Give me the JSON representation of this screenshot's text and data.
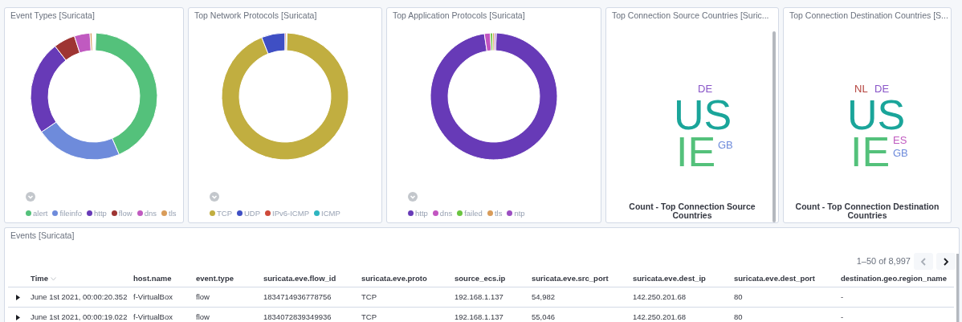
{
  "panels": [
    {
      "kind": "donut",
      "title": "Event Types [Suricata]",
      "legend": [
        {
          "label": "alert",
          "color": "#54c17b"
        },
        {
          "label": "fileinfo",
          "color": "#6e8bdb"
        },
        {
          "label": "http",
          "color": "#673ab7"
        },
        {
          "label": "flow",
          "color": "#9e3533"
        },
        {
          "label": "dns",
          "color": "#c05ac0"
        },
        {
          "label": "tls",
          "color": "#d99c5a"
        }
      ]
    },
    {
      "kind": "donut",
      "title": "Top Network Protocols [Suricata]",
      "legend": [
        {
          "label": "TCP",
          "color": "#c1ae40"
        },
        {
          "label": "UDP",
          "color": "#3f4fc4"
        },
        {
          "label": "IPv6-ICMP",
          "color": "#cf4a3a"
        },
        {
          "label": "ICMP",
          "color": "#2eb5c0"
        }
      ]
    },
    {
      "kind": "donut",
      "title": "Top Application Protocols [Suricata]",
      "legend": [
        {
          "label": "http",
          "color": "#673ab7"
        },
        {
          "label": "dns",
          "color": "#c255c1"
        },
        {
          "label": "failed",
          "color": "#6ac440"
        },
        {
          "label": "tls",
          "color": "#d99c5a"
        },
        {
          "label": "ntp",
          "color": "#9b4ec2"
        }
      ]
    },
    {
      "kind": "cloud",
      "title": "Top Connection Source Countries [Suric...",
      "caption": "Count - Top Connection Source Countries",
      "words": [
        {
          "text": "DE",
          "kind": "small",
          "color": "#8a56c8"
        },
        {
          "text": "US",
          "kind": "large",
          "color": "#1aa59a"
        },
        {
          "text": "IE",
          "kind": "large",
          "color": "#54c17b"
        },
        {
          "text": "GB",
          "kind": "small",
          "color": "#6e8bdb"
        }
      ]
    },
    {
      "kind": "cloud",
      "title": "Top Connection Destination Countries [S...",
      "caption": "Count - Top Connection Destination Countries",
      "words": [
        {
          "text": "NL",
          "kind": "small",
          "color": "#b5443e"
        },
        {
          "text": "DE",
          "kind": "small",
          "color": "#8a56c8"
        },
        {
          "text": "US",
          "kind": "large",
          "color": "#1aa59a"
        },
        {
          "text": "IE",
          "kind": "large",
          "color": "#54c17b"
        },
        {
          "text": "ES",
          "kind": "small",
          "color": "#c05ac0"
        },
        {
          "text": "GB",
          "kind": "small",
          "color": "#6e8bdb"
        }
      ]
    }
  ],
  "events": {
    "title": "Events [Suricata]",
    "pager": {
      "text": "1–50 of 8,997",
      "prev_disabled": true,
      "next_disabled": false
    },
    "table": {
      "columns": [
        "Time",
        "host.name",
        "event.type",
        "suricata.eve.flow_id",
        "suricata.eve.proto",
        "source_ecs.ip",
        "suricata.eve.src_port",
        "suricata.eve.dest_ip",
        "suricata.eve.dest_port",
        "destination.geo.region_name"
      ],
      "rows": [
        [
          "June 1st 2021, 00:00:20.352",
          "f-VirtualBox",
          "flow",
          "1834714936778756",
          "TCP",
          "192.168.1.137",
          "54,982",
          "142.250.201.68",
          "80",
          "-"
        ],
        [
          "June 1st 2021, 00:00:19.022",
          "f-VirtualBox",
          "flow",
          "1834072839349936",
          "TCP",
          "192.168.1.137",
          "55,046",
          "142.250.201.68",
          "80",
          "-"
        ]
      ]
    }
  }
}
